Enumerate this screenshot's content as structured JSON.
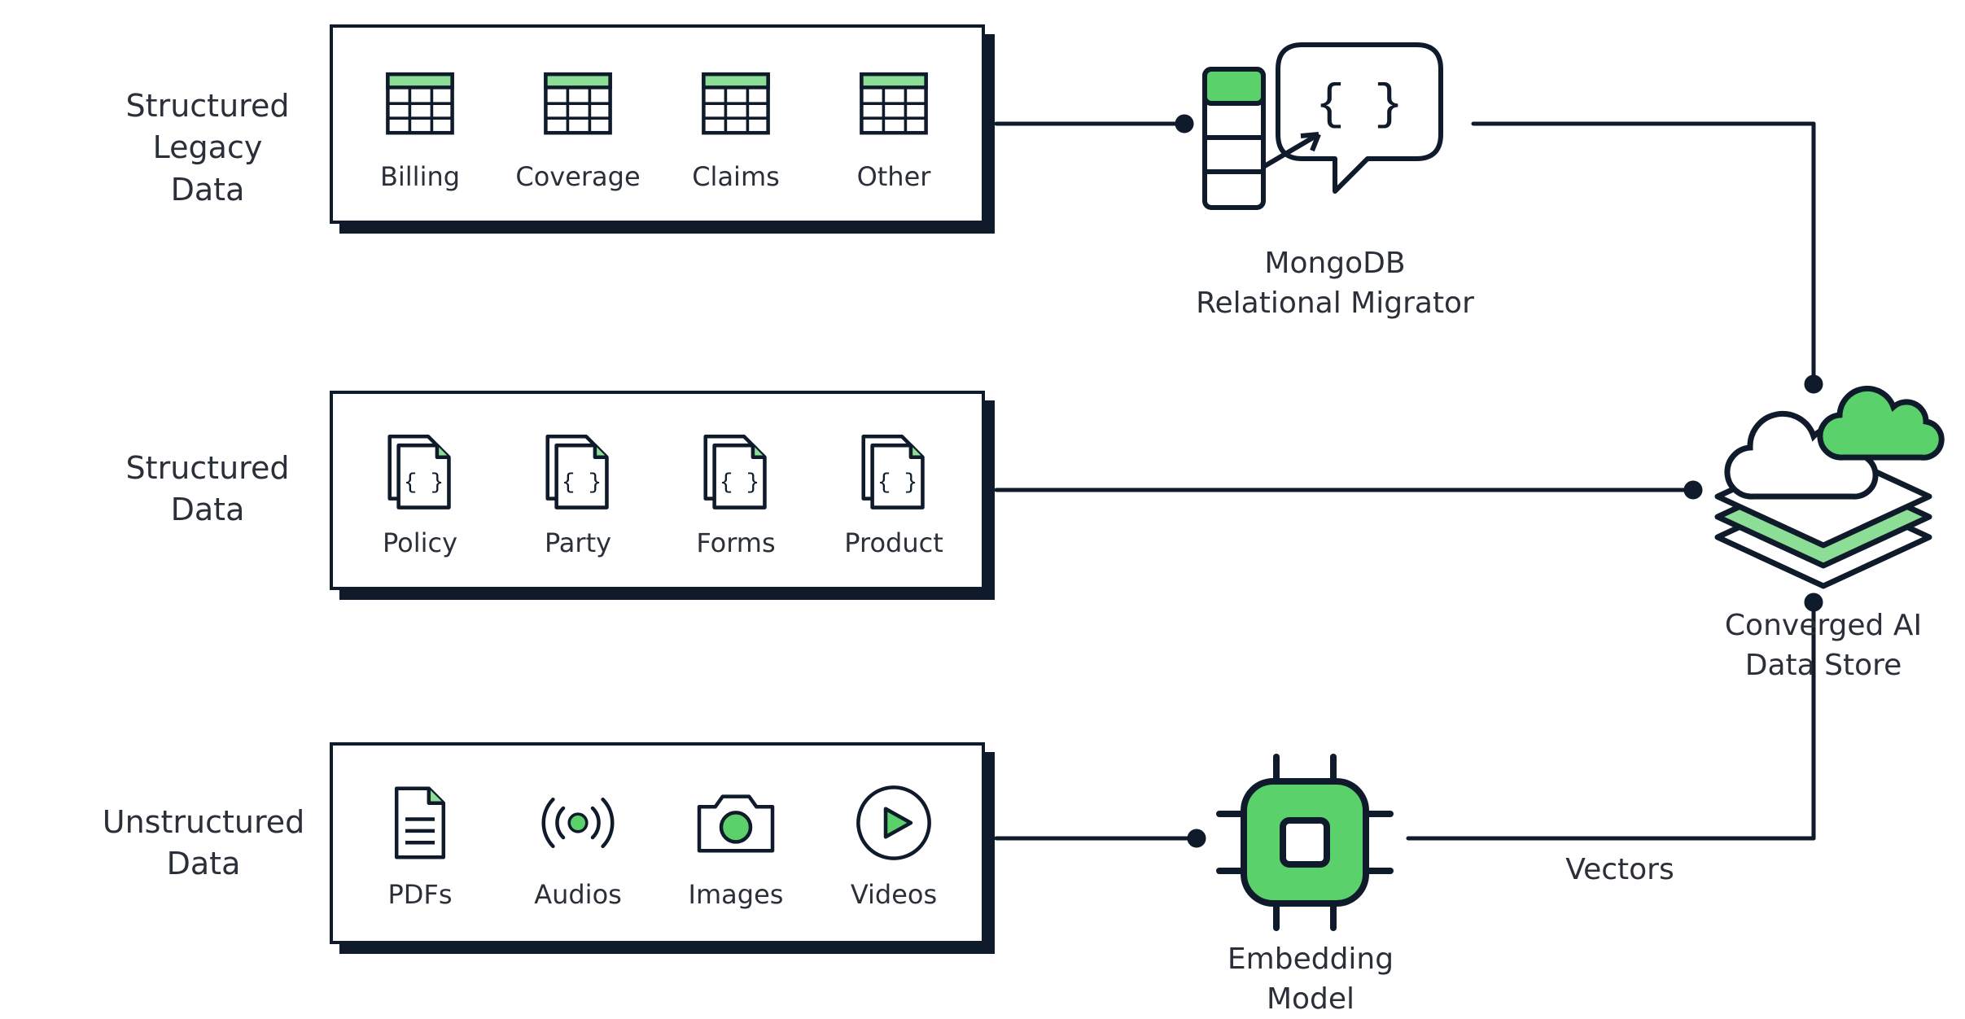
{
  "sections": {
    "legacy": {
      "label_line1": "Structured",
      "label_line2": "Legacy Data"
    },
    "structured": {
      "label_line1": "Structured",
      "label_line2": "Data"
    },
    "unstructured": {
      "label_line1": "Unstructured",
      "label_line2": "Data"
    }
  },
  "panels": {
    "legacy": {
      "items": [
        {
          "label": "Billing"
        },
        {
          "label": "Coverage"
        },
        {
          "label": "Claims"
        },
        {
          "label": "Other"
        }
      ]
    },
    "structured": {
      "items": [
        {
          "label": "Policy"
        },
        {
          "label": "Party"
        },
        {
          "label": "Forms"
        },
        {
          "label": "Product"
        }
      ]
    },
    "unstructured": {
      "items": [
        {
          "label": "PDFs"
        },
        {
          "label": "Audios"
        },
        {
          "label": "Images"
        },
        {
          "label": "Videos"
        }
      ]
    }
  },
  "processors": {
    "migrator": {
      "line1": "MongoDB",
      "line2": "Relational Migrator"
    },
    "embedding": {
      "line1": "Embedding",
      "line2": "Model"
    }
  },
  "destination": {
    "line1": "Converged AI",
    "line2": "Data Store"
  },
  "edges": {
    "vectors_label": "Vectors"
  }
}
